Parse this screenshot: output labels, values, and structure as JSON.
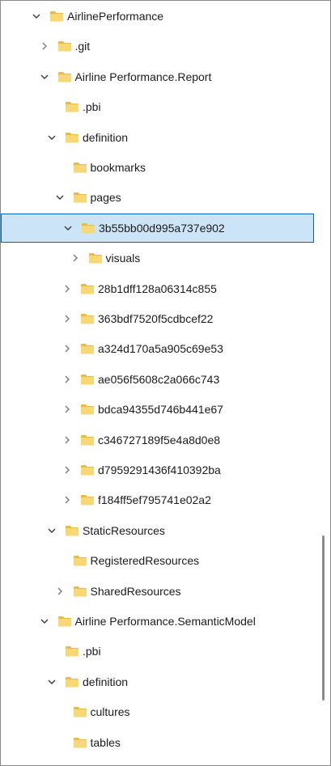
{
  "tree": [
    {
      "label": "AirlinePerformance",
      "level": 0,
      "chevron": "expanded"
    },
    {
      "label": ".git",
      "level": 1,
      "chevron": "collapsed"
    },
    {
      "label": "Airline Performance.Report",
      "level": 1,
      "chevron": "expanded"
    },
    {
      "label": ".pbi",
      "level": 2,
      "chevron": "none"
    },
    {
      "label": "definition",
      "level": 2,
      "chevron": "expanded"
    },
    {
      "label": "bookmarks",
      "level": 3,
      "chevron": "none"
    },
    {
      "label": "pages",
      "level": 3,
      "chevron": "expanded"
    },
    {
      "label": "3b55bb00d995a737e902",
      "level": 4,
      "chevron": "expanded",
      "selected": true
    },
    {
      "label": "visuals",
      "level": 5,
      "chevron": "collapsed"
    },
    {
      "label": "28b1dff128a06314c855",
      "level": 4,
      "chevron": "collapsed"
    },
    {
      "label": "363bdf7520f5cdbcef22",
      "level": 4,
      "chevron": "collapsed"
    },
    {
      "label": "a324d170a5a905c69e53",
      "level": 4,
      "chevron": "collapsed"
    },
    {
      "label": "ae056f5608c2a066c743",
      "level": 4,
      "chevron": "collapsed"
    },
    {
      "label": "bdca94355d746b441e67",
      "level": 4,
      "chevron": "collapsed"
    },
    {
      "label": "c346727189f5e4a8d0e8",
      "level": 4,
      "chevron": "collapsed"
    },
    {
      "label": "d7959291436f410392ba",
      "level": 4,
      "chevron": "collapsed"
    },
    {
      "label": "f184ff5ef795741e02a2",
      "level": 4,
      "chevron": "collapsed"
    },
    {
      "label": "StaticResources",
      "level": 2,
      "chevron": "expanded"
    },
    {
      "label": "RegisteredResources",
      "level": 3,
      "chevron": "none"
    },
    {
      "label": "SharedResources",
      "level": 3,
      "chevron": "collapsed"
    },
    {
      "label": "Airline Performance.SemanticModel",
      "level": 1,
      "chevron": "expanded"
    },
    {
      "label": ".pbi",
      "level": 2,
      "chevron": "none"
    },
    {
      "label": "definition",
      "level": 2,
      "chevron": "expanded"
    },
    {
      "label": "cultures",
      "level": 3,
      "chevron": "none"
    },
    {
      "label": "tables",
      "level": 3,
      "chevron": "none"
    }
  ],
  "colors": {
    "folder_body": "#f8d775",
    "folder_tab": "#e9b94a",
    "selection_bg": "#cce4f7",
    "selection_border": "#0067c0"
  }
}
